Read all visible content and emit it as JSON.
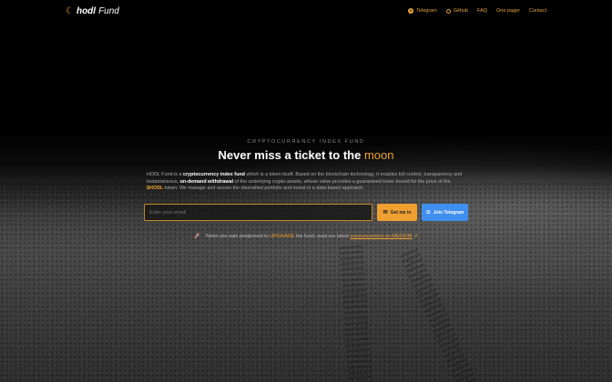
{
  "brand": {
    "name_bold": "hodl",
    "name_light": "Fund",
    "logo_icon": "crescent-moon-icon"
  },
  "nav": {
    "items": [
      {
        "label": "Telegram",
        "icon": "telegram-icon"
      },
      {
        "label": "Github",
        "icon": "github-icon"
      },
      {
        "label": "FAQ"
      },
      {
        "label": "One pager"
      },
      {
        "label": "Contact"
      }
    ]
  },
  "hero": {
    "kicker": "CRYPTOCURRENCY INDEX FUND",
    "title_prefix": "Never miss a ticket to the ",
    "title_accent": "moon",
    "desc": {
      "p1": "HODL Fund is a ",
      "b1": "cryptocurrency index fund",
      "p2": " which is a token itself. Based on the blockchain technology, it enables full control, transparency and instantaneous, ",
      "b2": "on-demand withdrawal",
      "p3": " of the underlying crypto assets, whose value provides a guaranteed lower bound for the price of the ",
      "hl": "$HODL",
      "p4": " token. We manage and secure the diversified portfolio and invest in a data-based approach."
    }
  },
  "form": {
    "email_placeholder": "Enter your email",
    "get_me_in": "Get me in",
    "join_telegram": "Join Telegram"
  },
  "notice": {
    "t1": "Token pre-sale postponed to ",
    "upgrade": "UPGRADE",
    "t2": " the fund, read our latest ",
    "link": "announcement on MEDIUM"
  },
  "colors": {
    "accent": "#f0a030",
    "telegram_blue": "#3f8ff0"
  }
}
